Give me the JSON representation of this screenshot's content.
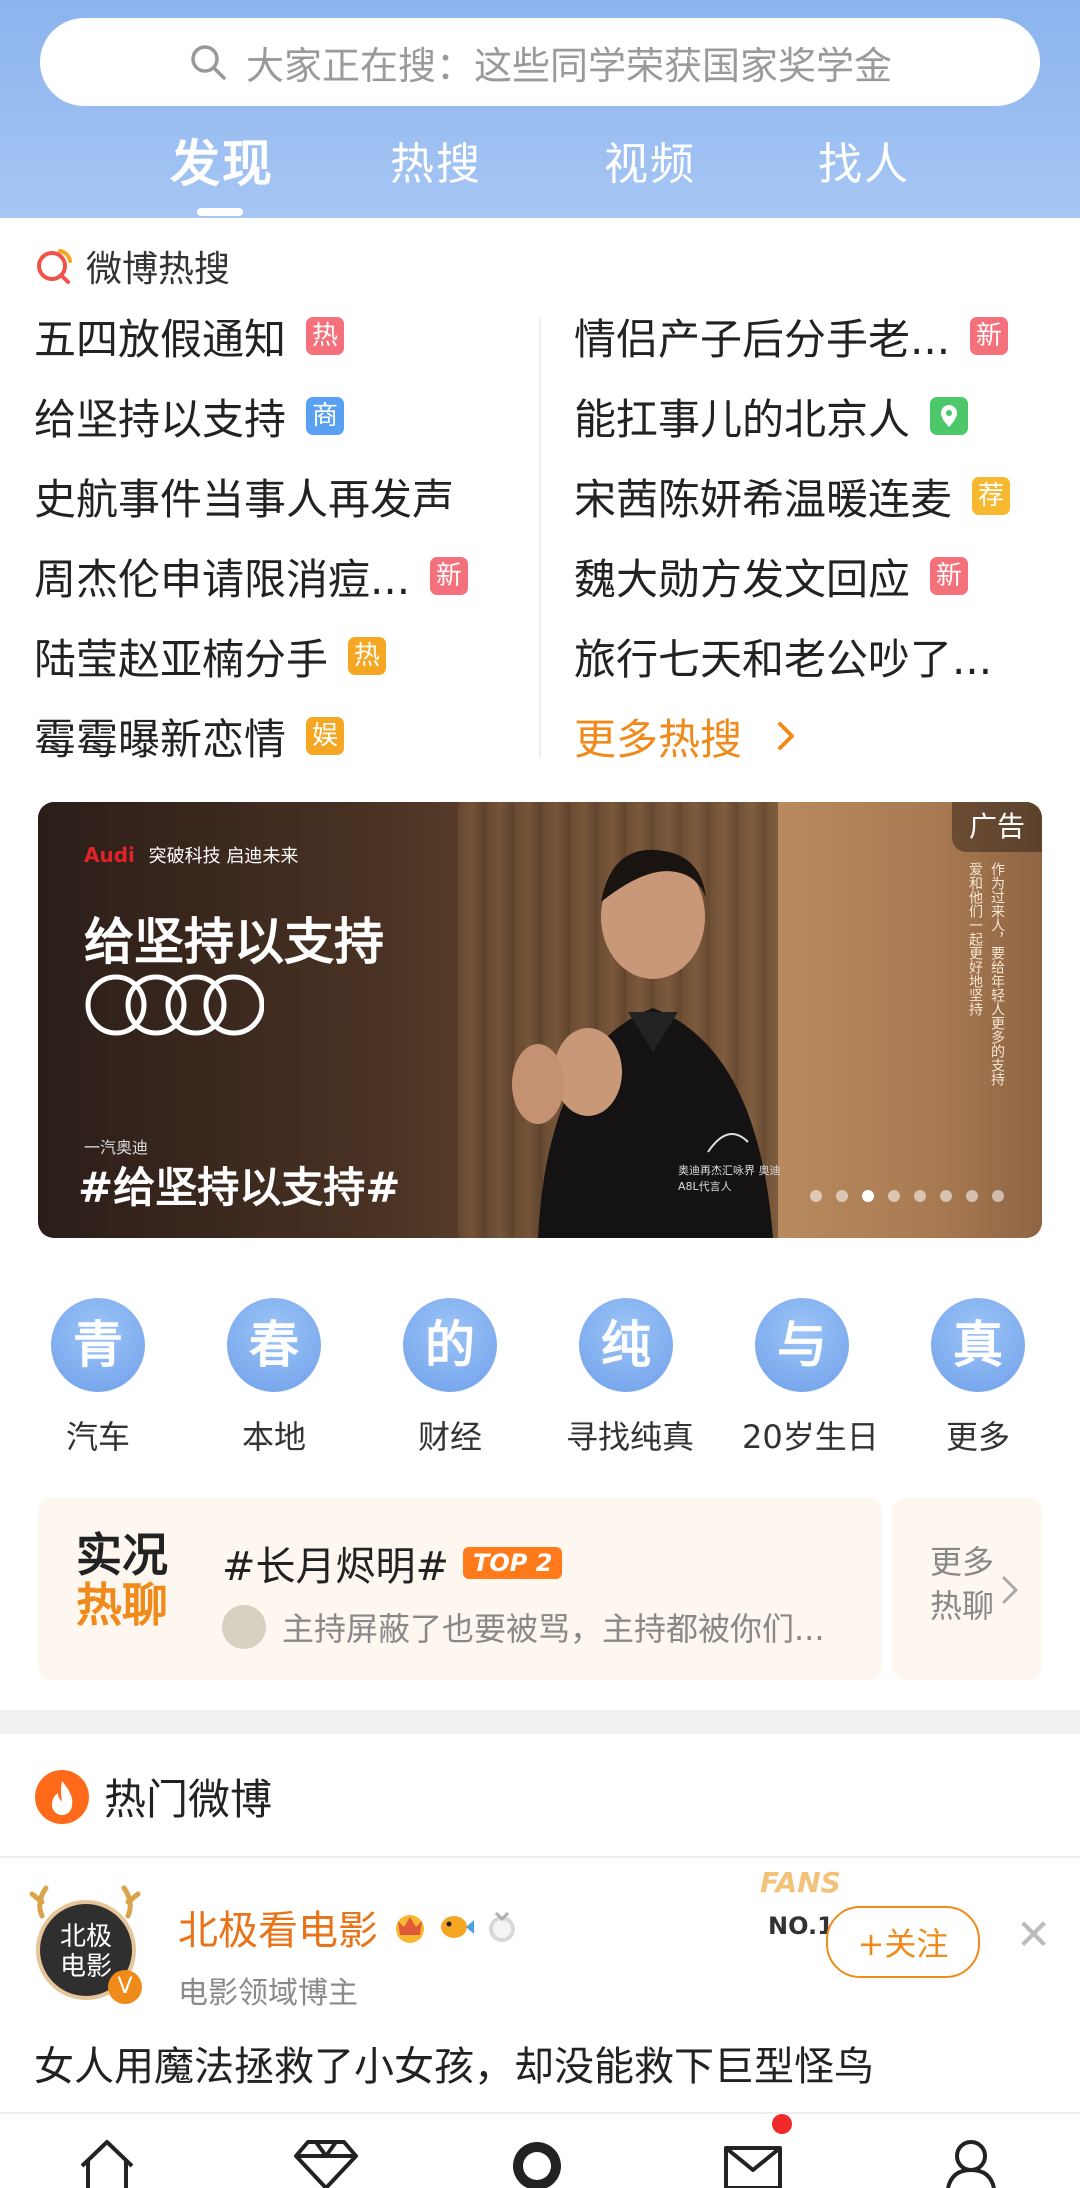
{
  "search": {
    "placeholder": "大家正在搜：这些同学荣获国家奖学金"
  },
  "tabs": [
    {
      "label": "发现",
      "active": true
    },
    {
      "label": "热搜",
      "active": false
    },
    {
      "label": "视频",
      "active": false
    },
    {
      "label": "找人",
      "active": false
    }
  ],
  "hot_search": {
    "title": "微博热搜",
    "left": [
      {
        "text": "五四放假通知",
        "badge": "热",
        "badge_color": "#f4707a"
      },
      {
        "text": "给坚持以支持",
        "badge": "商",
        "badge_color": "#5aa0f2"
      },
      {
        "text": "史航事件当事人再发声",
        "badge": "",
        "badge_color": ""
      },
      {
        "text": "周杰伦申请限消痘...",
        "badge": "新",
        "badge_color": "#f4707a"
      },
      {
        "text": "陆莹赵亚楠分手",
        "badge": "热",
        "badge_color": "#f5a623"
      },
      {
        "text": "霉霉曝新恋情",
        "badge": "娱",
        "badge_color": "#f5a623"
      }
    ],
    "right": [
      {
        "text": "情侣产子后分手老...",
        "badge": "新",
        "badge_color": "#f4707a"
      },
      {
        "text": "能扛事儿的北京人",
        "badge": "location-icon",
        "badge_color": "#4cc86a"
      },
      {
        "text": "宋茜陈妍希温暖连麦",
        "badge": "荐",
        "badge_color": "#f5b82e"
      },
      {
        "text": "魏大勋方发文回应",
        "badge": "新",
        "badge_color": "#f4707a"
      },
      {
        "text": "旅行七天和老公吵了...",
        "badge": "",
        "badge_color": ""
      }
    ],
    "more": "更多热搜"
  },
  "banner": {
    "brand": "Audi",
    "brand_tagline": "突破科技 启迪未来",
    "headline": "给坚持以支持",
    "sub": "一汽奥迪",
    "hashtag": "#给坚持以支持#",
    "ad_label": "广告",
    "vertical_text": "作为过来人，要给年轻人更多的支持 爱和他们一起更好地坚持",
    "signature_note": "奥迪再杰汇咏界 奥迪A8L代言人",
    "dots_total": 8,
    "dots_active": 2
  },
  "categories": [
    {
      "char": "青",
      "label": "汽车"
    },
    {
      "char": "春",
      "label": "本地"
    },
    {
      "char": "的",
      "label": "财经"
    },
    {
      "char": "纯",
      "label": "寻找纯真"
    },
    {
      "char": "与",
      "label": "20岁生日"
    },
    {
      "char": "真",
      "label": "更多"
    }
  ],
  "live_chat": {
    "logo_line1": "实况",
    "logo_line2": "热聊",
    "topic": "#长月烬明#",
    "top_badge": "TOP 2",
    "comment": "主持屏蔽了也要被骂，主持都被你们...",
    "more_line1": "更多",
    "more_line2": "热聊"
  },
  "hot_weibo": {
    "title": "热门微博",
    "post": {
      "avatar_line1": "北极",
      "avatar_line2": "电影",
      "name": "北极看电影",
      "desc": "电影领域博主",
      "fans_deco": "FANS",
      "rank": "NO.1",
      "follow": "+关注",
      "text": "女人用魔法拯救了小女孩，却没能救下巨型怪鸟"
    }
  },
  "bottom_nav": [
    {
      "icon": "home-icon"
    },
    {
      "icon": "diamond-icon"
    },
    {
      "icon": "discover-icon"
    },
    {
      "icon": "message-icon",
      "unread": true
    },
    {
      "icon": "profile-icon"
    }
  ]
}
